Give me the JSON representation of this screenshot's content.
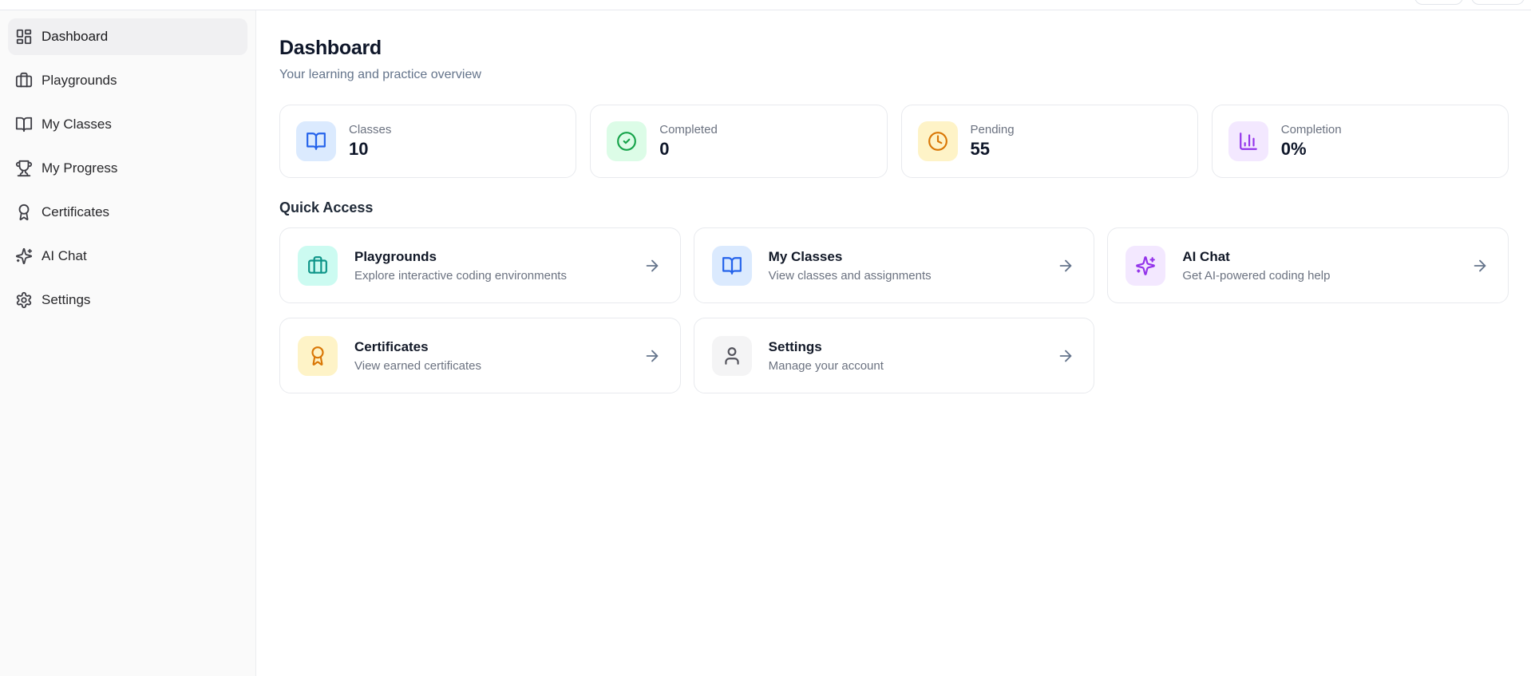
{
  "header": {
    "cut_buttons": [
      {
        "name": "cut-off-button-1"
      },
      {
        "name": "cut-off-button-2"
      }
    ]
  },
  "sidebar": {
    "items": [
      {
        "label": "Dashboard",
        "icon": "layout-dashboard",
        "active": true
      },
      {
        "label": "Playgrounds",
        "icon": "briefcase",
        "active": false
      },
      {
        "label": "My Classes",
        "icon": "book-open",
        "active": false
      },
      {
        "label": "My Progress",
        "icon": "trophy",
        "active": false
      },
      {
        "label": "Certificates",
        "icon": "award",
        "active": false
      },
      {
        "label": "AI Chat",
        "icon": "sparkles",
        "active": false
      },
      {
        "label": "Settings",
        "icon": "gear",
        "active": false
      }
    ]
  },
  "main": {
    "title": "Dashboard",
    "subtitle": "Your learning and practice overview",
    "stats": [
      {
        "label": "Classes",
        "value": "10",
        "icon": "book-open",
        "fg": "#2563eb",
        "bg": "#dbeafe"
      },
      {
        "label": "Completed",
        "value": "0",
        "icon": "circle-check",
        "fg": "#16a34a",
        "bg": "#dcfce7"
      },
      {
        "label": "Pending",
        "value": "55",
        "icon": "clock",
        "fg": "#d97706",
        "bg": "#fef3c7"
      },
      {
        "label": "Completion",
        "value": "0%",
        "icon": "bar-chart",
        "fg": "#9333ea",
        "bg": "#f3e8ff"
      }
    ],
    "quick_access": {
      "heading": "Quick Access",
      "cards": [
        {
          "title": "Playgrounds",
          "subtitle": "Explore interactive coding environments",
          "icon": "briefcase",
          "fg": "#0d9488",
          "bg": "#ccfbf1"
        },
        {
          "title": "My Classes",
          "subtitle": "View classes and assignments",
          "icon": "book-open",
          "fg": "#2563eb",
          "bg": "#dbeafe"
        },
        {
          "title": "AI Chat",
          "subtitle": "Get AI-powered coding help",
          "icon": "sparkles",
          "fg": "#9333ea",
          "bg": "#f3e8ff"
        },
        {
          "title": "Certificates",
          "subtitle": "View earned certificates",
          "icon": "award",
          "fg": "#d97706",
          "bg": "#fef3c7"
        },
        {
          "title": "Settings",
          "subtitle": "Manage your account",
          "icon": "user",
          "fg": "#52525b",
          "bg": "#f4f4f5"
        }
      ]
    }
  }
}
